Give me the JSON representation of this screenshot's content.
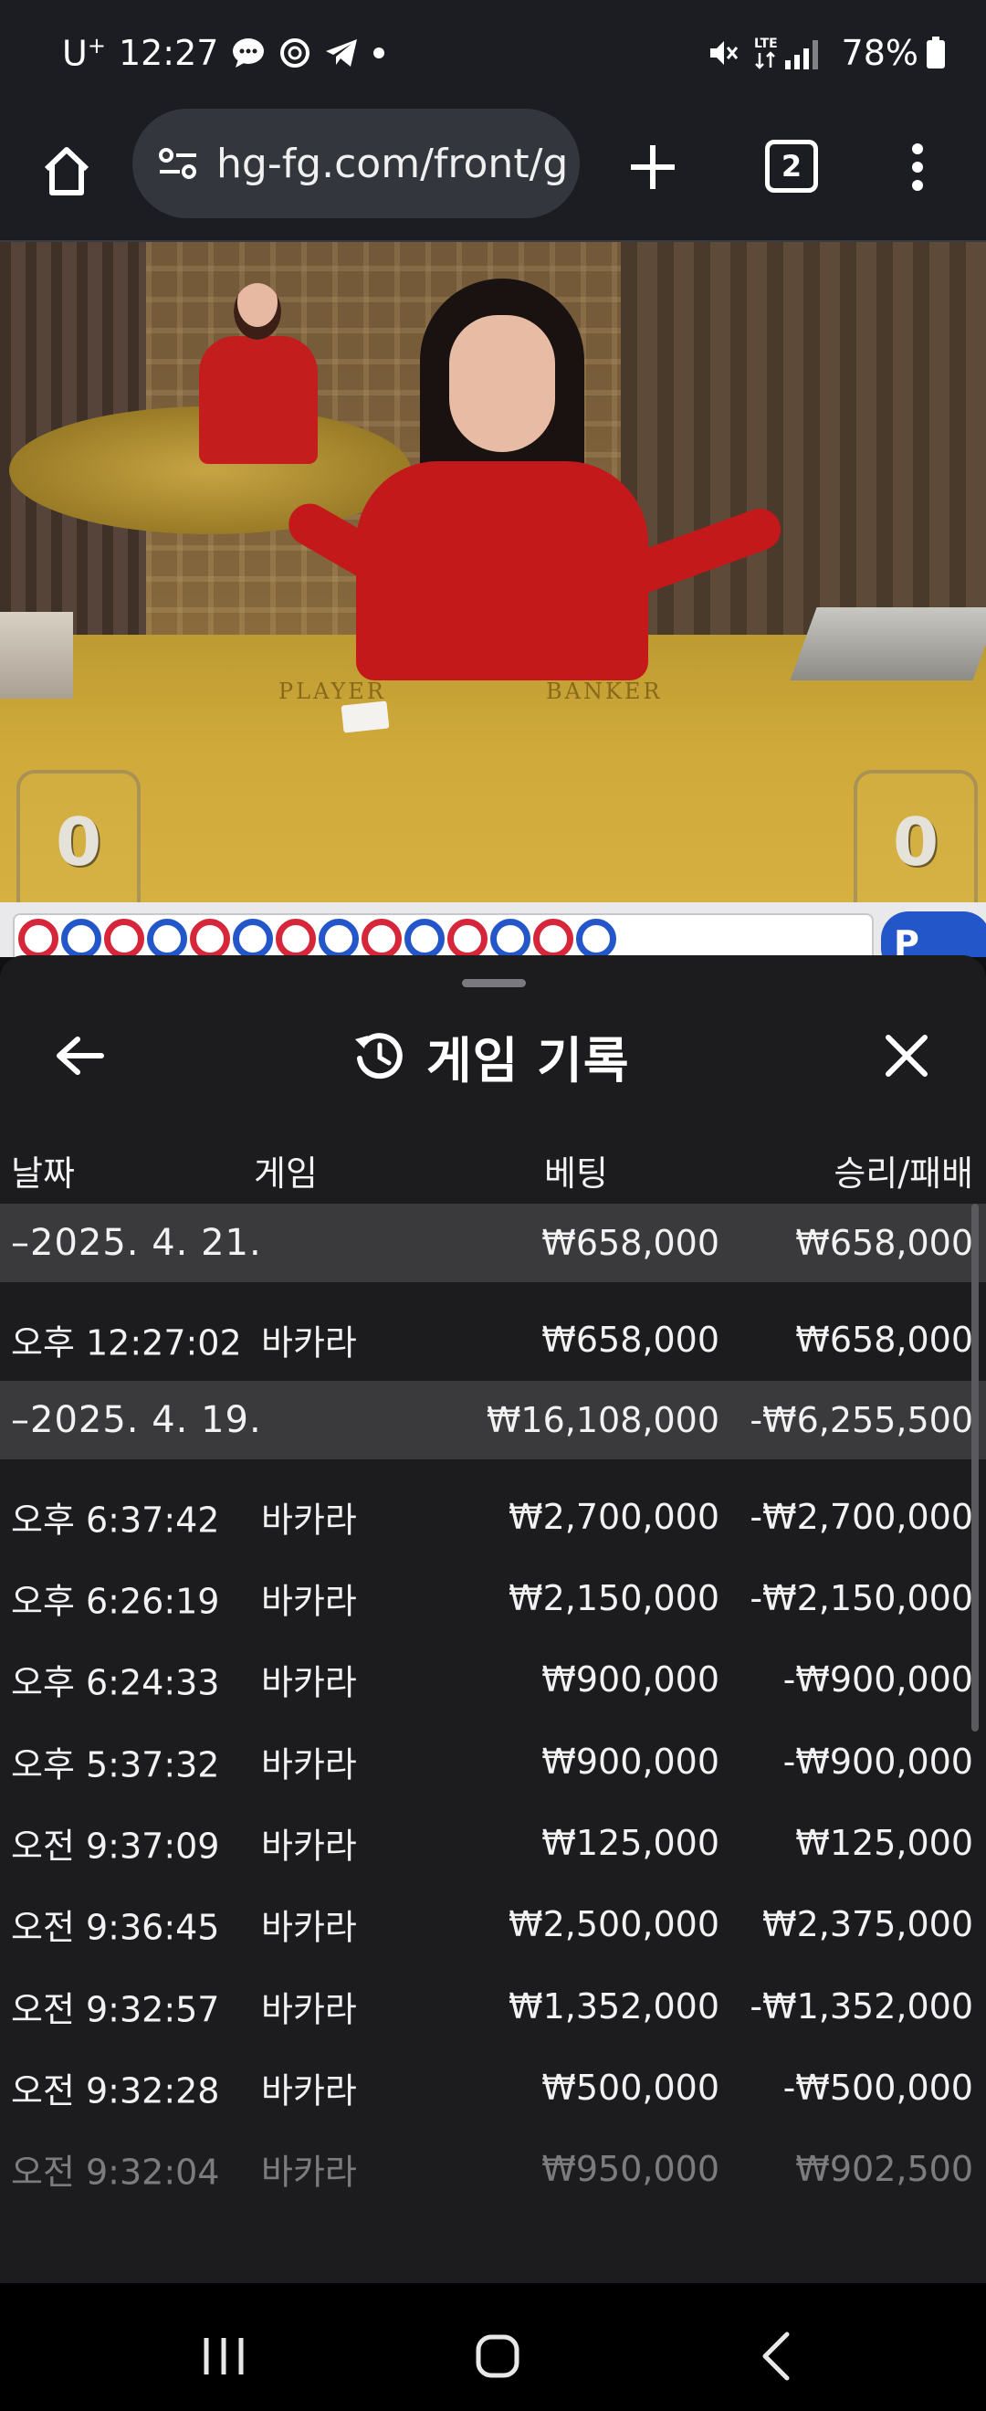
{
  "status_bar": {
    "carrier": "U",
    "carrier_sup": "+",
    "time": "12:27",
    "network": "LTE",
    "battery": "78%"
  },
  "browser": {
    "url": "hg-fg.com/front/g",
    "tab_count": "2"
  },
  "video": {
    "felt_player": "PLAYER",
    "felt_banker": "BANKER",
    "player_score": "0",
    "banker_score": "0"
  },
  "roadmap": {
    "colors": [
      "red",
      "blue",
      "red",
      "blue",
      "red",
      "blue",
      "red",
      "blue",
      "red",
      "blue",
      "red",
      "blue",
      "red",
      "blue"
    ],
    "button_label": "P",
    "red_color": "#d5263a",
    "blue_color": "#2356c8"
  },
  "sheet": {
    "title": "게임 기록",
    "columns": {
      "date": "날짜",
      "game": "게임",
      "bet": "베팅",
      "result": "승리/패배"
    },
    "rows": [
      {
        "type": "group",
        "date": "–2025. 4. 21.",
        "game": "",
        "bet": "₩658,000",
        "result": "₩658,000"
      },
      {
        "type": "entry",
        "date": "오후 12:27:02",
        "game": "바카라",
        "bet": "₩658,000",
        "result": "₩658,000"
      },
      {
        "type": "group",
        "date": "–2025. 4. 19.",
        "game": "",
        "bet": "₩16,108,000",
        "result": "-₩6,255,500"
      },
      {
        "type": "entry",
        "date": "오후 6:37:42",
        "game": "바카라",
        "bet": "₩2,700,000",
        "result": "-₩2,700,000"
      },
      {
        "type": "entry",
        "date": "오후 6:26:19",
        "game": "바카라",
        "bet": "₩2,150,000",
        "result": "-₩2,150,000"
      },
      {
        "type": "entry",
        "date": "오후 6:24:33",
        "game": "바카라",
        "bet": "₩900,000",
        "result": "-₩900,000"
      },
      {
        "type": "entry",
        "date": "오후 5:37:32",
        "game": "바카라",
        "bet": "₩900,000",
        "result": "-₩900,000"
      },
      {
        "type": "entry",
        "date": "오전 9:37:09",
        "game": "바카라",
        "bet": "₩125,000",
        "result": "₩125,000"
      },
      {
        "type": "entry",
        "date": "오전 9:36:45",
        "game": "바카라",
        "bet": "₩2,500,000",
        "result": "₩2,375,000"
      },
      {
        "type": "entry",
        "date": "오전 9:32:57",
        "game": "바카라",
        "bet": "₩1,352,000",
        "result": "-₩1,352,000"
      },
      {
        "type": "entry",
        "date": "오전 9:32:28",
        "game": "바카라",
        "bet": "₩500,000",
        "result": "-₩500,000"
      },
      {
        "type": "entry",
        "date": "오전 9:32:04",
        "game": "바카라",
        "bet": "₩950,000",
        "result": "₩902,500"
      }
    ]
  },
  "icons": {
    "status": [
      "chat-bubble-icon",
      "data-saver-icon",
      "telegram-icon",
      "dot-icon",
      "mute-icon",
      "lte-signal-icon",
      "battery-icon"
    ],
    "browser": [
      "home-icon",
      "site-settings-icon",
      "new-tab-icon",
      "tab-switcher-icon",
      "more-menu-icon"
    ],
    "sheet": [
      "back-arrow-icon",
      "history-icon",
      "close-icon"
    ],
    "nav": [
      "recents-icon",
      "home-circle-icon",
      "back-chevron-icon"
    ]
  }
}
